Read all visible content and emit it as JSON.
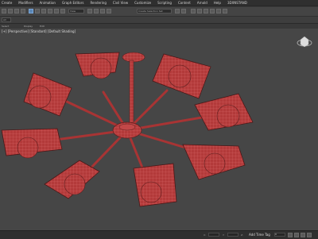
{
  "menu": [
    "Create",
    "Modifiers",
    "Animation",
    "Graph Editors",
    "Rendering",
    "Civil View",
    "Customize",
    "Scripting",
    "Content",
    "Arnold",
    "Help",
    "3DXNSTAND"
  ],
  "toolbar": {
    "dropdown1": "All",
    "dropdown2": "View",
    "selection_set": "Create Selection Set",
    "tab_select": "Select",
    "tab_display": "Display",
    "tab_edit": "Edit"
  },
  "viewport": {
    "label": "[+] [Perspective] [Standard] [Default Shading]",
    "colors": {
      "wire": "#b63a3a",
      "edge": "#d86060",
      "background": "#464646"
    }
  },
  "status": {
    "add_time_tag": "Add Time Tag",
    "frame_value": "0",
    "x": "X:",
    "y": "Y:",
    "z": "Z:"
  }
}
